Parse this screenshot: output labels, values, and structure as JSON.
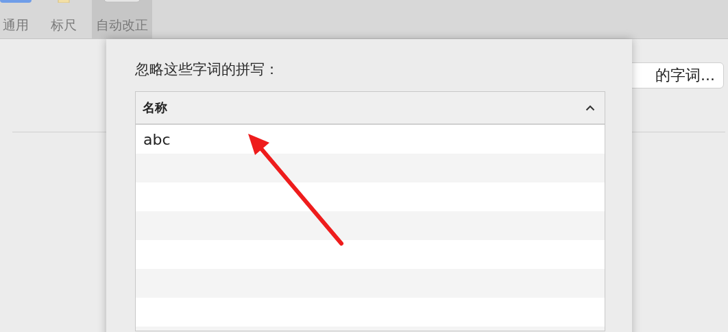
{
  "toolbar": {
    "tabs": [
      {
        "label": "通用",
        "kind": "general",
        "selected": false
      },
      {
        "label": "标尺",
        "kind": "ruler",
        "selected": false
      },
      {
        "label": "自动改正",
        "kind": "autocorrect",
        "selected": true
      }
    ]
  },
  "background": {
    "button": {
      "label": "的字词..."
    }
  },
  "sheet": {
    "heading": "忽略这些字词的拼写：",
    "table": {
      "columns": [
        {
          "label": "名称",
          "sort_ascending": true
        }
      ],
      "rows": [
        {
          "name": "abc"
        }
      ]
    }
  }
}
